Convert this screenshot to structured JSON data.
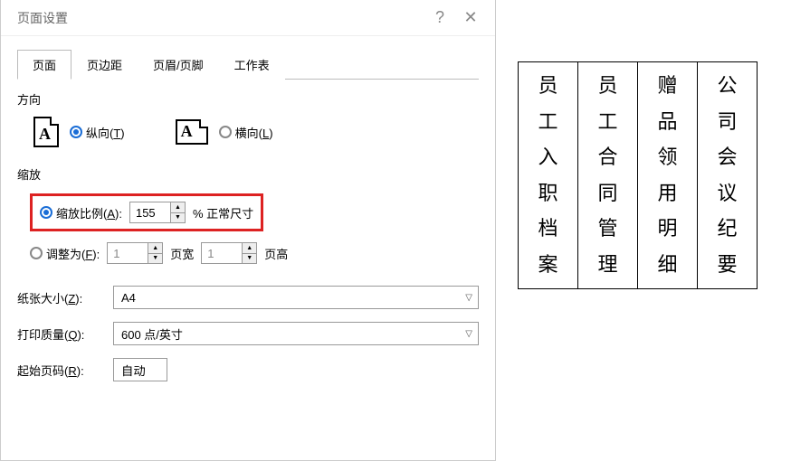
{
  "dialog": {
    "title": "页面设置",
    "tabs": [
      "页面",
      "页边距",
      "页眉/页脚",
      "工作表"
    ],
    "active_tab": 0,
    "orientation": {
      "label": "方向",
      "portrait_pre": "纵向(",
      "portrait_key": "T",
      "portrait_post": ")",
      "landscape_pre": "横向(",
      "landscape_key": "L",
      "landscape_post": ")",
      "selected": "portrait"
    },
    "scaling": {
      "label": "缩放",
      "adjust_pre": "缩放比例(",
      "adjust_key": "A",
      "adjust_post": "):",
      "adjust_value": "155",
      "adjust_suffix": "% 正常尺寸",
      "fit_pre": "调整为(",
      "fit_key": "F",
      "fit_post": "):",
      "fit_w": "1",
      "fit_w_suffix": "页宽",
      "fit_h": "1",
      "fit_h_suffix": "页高",
      "selected": "adjust"
    },
    "paper_size": {
      "label_pre": "纸张大小(",
      "label_key": "Z",
      "label_post": "):",
      "value": "A4"
    },
    "print_quality": {
      "label_pre": "打印质量(",
      "label_key": "Q",
      "label_post": "):",
      "value": "600 点/英寸"
    },
    "first_page": {
      "label_pre": "起始页码(",
      "label_key": "R",
      "label_post": "):",
      "value": "自动"
    }
  },
  "preview": {
    "columns": [
      [
        "员",
        "工",
        "入",
        "职",
        "档",
        "案"
      ],
      [
        "员",
        "工",
        "合",
        "同",
        "管",
        "理"
      ],
      [
        "赠",
        "品",
        "领",
        "用",
        "明",
        "细"
      ],
      [
        "公",
        "司",
        "会",
        "议",
        "纪",
        "要"
      ]
    ]
  }
}
